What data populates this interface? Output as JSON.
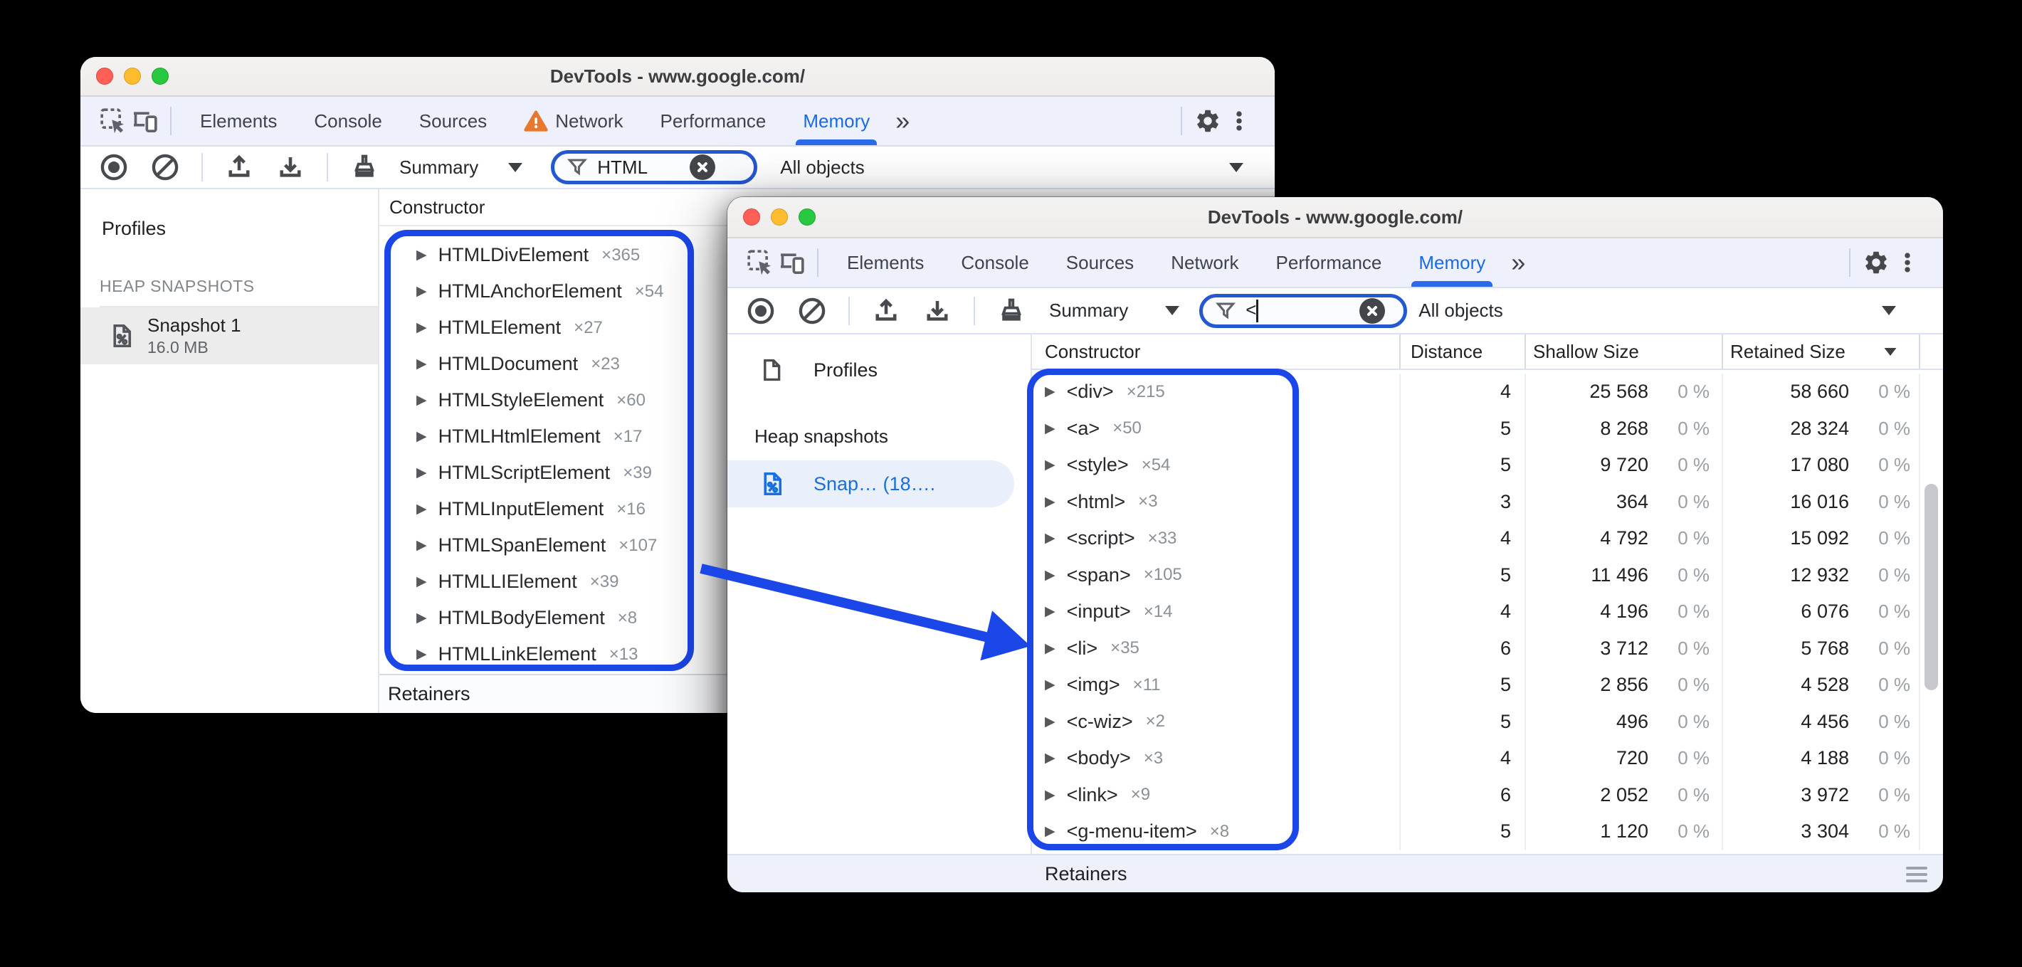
{
  "annotation_color": "#1b46e8",
  "back_window": {
    "title": "DevTools - www.google.com/",
    "tabs": [
      "Elements",
      "Console",
      "Sources",
      "Network",
      "Performance",
      "Memory"
    ],
    "overflow_chevron": "»",
    "toolbar": {
      "mode": "Summary",
      "filter_value": "HTML",
      "scope": "All objects"
    },
    "sidebar": {
      "profiles_label": "Profiles",
      "section_label": "HEAP SNAPSHOTS",
      "snapshot_name": "Snapshot 1",
      "snapshot_size": "16.0 MB"
    },
    "grid": {
      "constructor_header": "Constructor",
      "retainers_label": "Retainers",
      "rows": [
        {
          "name": "HTMLDivElement",
          "count": "×365"
        },
        {
          "name": "HTMLAnchorElement",
          "count": "×54"
        },
        {
          "name": "HTMLElement",
          "count": "×27"
        },
        {
          "name": "HTMLDocument",
          "count": "×23"
        },
        {
          "name": "HTMLStyleElement",
          "count": "×60"
        },
        {
          "name": "HTMLHtmlElement",
          "count": "×17"
        },
        {
          "name": "HTMLScriptElement",
          "count": "×39"
        },
        {
          "name": "HTMLInputElement",
          "count": "×16"
        },
        {
          "name": "HTMLSpanElement",
          "count": "×107"
        },
        {
          "name": "HTMLLIElement",
          "count": "×39"
        },
        {
          "name": "HTMLBodyElement",
          "count": "×8"
        },
        {
          "name": "HTMLLinkElement",
          "count": "×13"
        }
      ]
    }
  },
  "front_window": {
    "title": "DevTools - www.google.com/",
    "tabs": [
      "Elements",
      "Console",
      "Sources",
      "Network",
      "Performance",
      "Memory"
    ],
    "overflow_chevron": "»",
    "toolbar": {
      "mode": "Summary",
      "filter_value": "<",
      "scope": "All objects"
    },
    "sidebar": {
      "profiles_label": "Profiles",
      "section_label": "Heap snapshots",
      "snapshot_name": "Snap…  (18…."
    },
    "grid": {
      "headers": [
        "Constructor",
        "Distance",
        "Shallow Size",
        "Retained Size"
      ],
      "sort_column": "Retained Size",
      "retainers_label": "Retainers",
      "rows": [
        {
          "name": "<div>",
          "count": "×215",
          "distance": "4",
          "shallow": "25 568",
          "shallow_pct": "0 %",
          "retained": "58 660",
          "retained_pct": "0 %"
        },
        {
          "name": "<a>",
          "count": "×50",
          "distance": "5",
          "shallow": "8 268",
          "shallow_pct": "0 %",
          "retained": "28 324",
          "retained_pct": "0 %"
        },
        {
          "name": "<style>",
          "count": "×54",
          "distance": "5",
          "shallow": "9 720",
          "shallow_pct": "0 %",
          "retained": "17 080",
          "retained_pct": "0 %"
        },
        {
          "name": "<html>",
          "count": "×3",
          "distance": "3",
          "shallow": "364",
          "shallow_pct": "0 %",
          "retained": "16 016",
          "retained_pct": "0 %"
        },
        {
          "name": "<script>",
          "count": "×33",
          "distance": "4",
          "shallow": "4 792",
          "shallow_pct": "0 %",
          "retained": "15 092",
          "retained_pct": "0 %"
        },
        {
          "name": "<span>",
          "count": "×105",
          "distance": "5",
          "shallow": "11 496",
          "shallow_pct": "0 %",
          "retained": "12 932",
          "retained_pct": "0 %"
        },
        {
          "name": "<input>",
          "count": "×14",
          "distance": "4",
          "shallow": "4 196",
          "shallow_pct": "0 %",
          "retained": "6 076",
          "retained_pct": "0 %"
        },
        {
          "name": "<li>",
          "count": "×35",
          "distance": "6",
          "shallow": "3 712",
          "shallow_pct": "0 %",
          "retained": "5 768",
          "retained_pct": "0 %"
        },
        {
          "name": "<img>",
          "count": "×11",
          "distance": "5",
          "shallow": "2 856",
          "shallow_pct": "0 %",
          "retained": "4 528",
          "retained_pct": "0 %"
        },
        {
          "name": "<c-wiz>",
          "count": "×2",
          "distance": "5",
          "shallow": "496",
          "shallow_pct": "0 %",
          "retained": "4 456",
          "retained_pct": "0 %"
        },
        {
          "name": "<body>",
          "count": "×3",
          "distance": "4",
          "shallow": "720",
          "shallow_pct": "0 %",
          "retained": "4 188",
          "retained_pct": "0 %"
        },
        {
          "name": "<link>",
          "count": "×9",
          "distance": "6",
          "shallow": "2 052",
          "shallow_pct": "0 %",
          "retained": "3 972",
          "retained_pct": "0 %"
        },
        {
          "name": "<g-menu-item>",
          "count": "×8",
          "distance": "5",
          "shallow": "1 120",
          "shallow_pct": "0 %",
          "retained": "3 304",
          "retained_pct": "0 %"
        }
      ]
    }
  }
}
